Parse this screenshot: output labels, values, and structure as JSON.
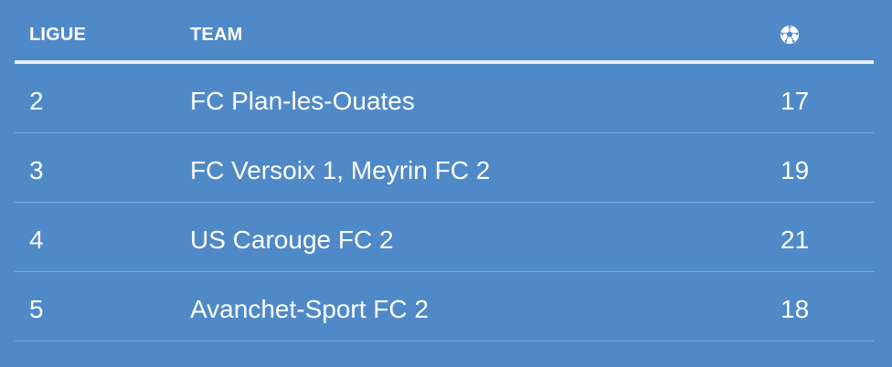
{
  "table": {
    "headers": {
      "ligue": "LIGUE",
      "team": "TEAM",
      "goals_icon": "soccer-ball-icon"
    },
    "rows": [
      {
        "ligue": "2",
        "team": "FC Plan-les-Ouates",
        "goals": "17"
      },
      {
        "ligue": "3",
        "team": "FC Versoix 1, Meyrin FC 2",
        "goals": "19"
      },
      {
        "ligue": "4",
        "team": "US Carouge FC 2",
        "goals": "21"
      },
      {
        "ligue": "5",
        "team": "Avanchet-Sport FC 2",
        "goals": "18"
      }
    ]
  },
  "colors": {
    "background": "#4f89c8",
    "text": "#ffffff",
    "header_rule": "#e7eef6"
  }
}
